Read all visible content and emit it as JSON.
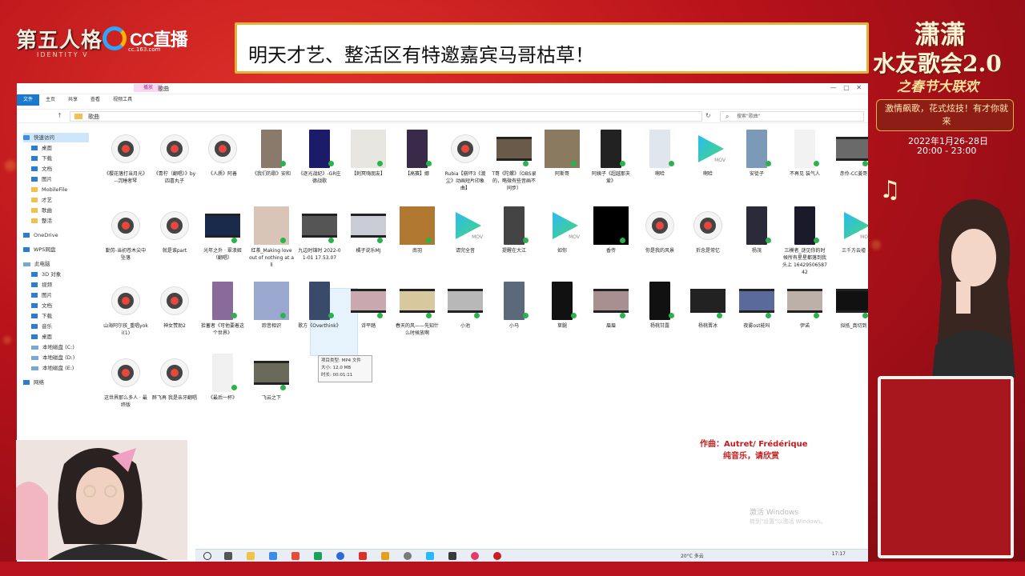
{
  "overlay": {
    "game_logo": "第五人格",
    "game_logo_sub": "IDENTITY V",
    "cc_logo": "CC直播",
    "cc_url": "cc.163.com",
    "banner": "明天才艺、整活区有特邀嘉宾马哥枯草！",
    "event_title": "潇潇",
    "event_title2": "水友歌会2.0",
    "event_sub": "之春节大联欢",
    "event_slogan": "激情飙歌，花式炫技！有才你就来",
    "event_date": "2022年1月26-28日",
    "event_time": "20:00 - 23:00",
    "lyric_credit": "作曲：Autret/ Frédérique",
    "lyric_credit2": "纯音乐，请欣赏",
    "windows_activate": "激活 Windows",
    "windows_activate2": "转到\"设置\"以激活 Windows。"
  },
  "explorer": {
    "window_title": "歌曲",
    "manage_tab": "播放",
    "ribbon_tabs": [
      "文件",
      "主页",
      "共享",
      "查看",
      "视频工具"
    ],
    "address": "歌曲",
    "search_placeholder": "搜索\"歌曲\"",
    "nav": [
      "快速访问",
      "桌面",
      "下载",
      "文档",
      "图片",
      "MobileFile",
      "才艺",
      "歌曲",
      "整活",
      "OneDrive",
      "WPS网盘",
      "此电脑",
      "3D 对象",
      "视频",
      "图片",
      "文档",
      "下载",
      "音乐",
      "桌面",
      "本地磁盘 (C:)",
      "本地磁盘 (D:)",
      "本地磁盘 (E:)",
      "网络"
    ],
    "files_row1": [
      {
        "name": "《樱花落打当月光》--沉睡者琴",
        "kind": "audio"
      },
      {
        "name": "《青柠（翻唱）》by四喜丸子",
        "kind": "audio"
      },
      {
        "name": "《人质》阿善",
        "kind": "audio"
      },
      {
        "name": "《我们的歌》安和",
        "kind": "video-portrait",
        "color": "#8a7a6c"
      },
      {
        "name": "《逐光战纪》-GR庄德战歌",
        "kind": "video-portrait",
        "color": "#1b1b6a"
      },
      {
        "name": "【刺冥嗨朋友】",
        "kind": "square",
        "color": "#e8e6e0"
      },
      {
        "name": "【高赛】娜",
        "kind": "video-portrait",
        "color": "#3a2a4a"
      },
      {
        "name": "Rubia【崩坏3《渡尘》动画短片印象曲】",
        "kind": "audio"
      },
      {
        "name": "T哥《陀螺》（OBS录的，略微有些音画不同步）",
        "kind": "landscape",
        "color": "#6a5a4a"
      },
      {
        "name": "阿斯哥",
        "kind": "square",
        "color": "#8a7a60"
      },
      {
        "name": "阿姨子《超越那夫爱》",
        "kind": "video-portrait",
        "color": "#222"
      },
      {
        "name": "啊哈",
        "kind": "video-portrait",
        "color": "#dfe6ee"
      },
      {
        "name": "啊哈",
        "kind": "qq"
      },
      {
        "name": "安徒子",
        "kind": "video-portrait",
        "color": "#7a9ab8"
      },
      {
        "name": "不再见 装气人",
        "kind": "video-portrait",
        "color": "#f2f2f2"
      },
      {
        "name": "赤伶-CC姜哥",
        "kind": "landscape",
        "color": "#6a6a6a"
      }
    ],
    "files_row2": [
      {
        "name": "勤劳-当初苍木尖中坠落",
        "kind": "audio"
      },
      {
        "name": "就是谁part",
        "kind": "audio"
      },
      {
        "name": "光年之外 · 翠浪姬（翻唱）",
        "kind": "landscape",
        "color": "#1a2a4a"
      },
      {
        "name": "红茶_Making love out of nothing at all",
        "kind": "square",
        "color": "#d9c5b8"
      },
      {
        "name": "九边时锦时 2022-01-01 17.53.07",
        "kind": "landscape",
        "color": "#555"
      },
      {
        "name": "橘子说乐MJ",
        "kind": "landscape",
        "color": "#c9ccd4"
      },
      {
        "name": "南羽",
        "kind": "square",
        "color": "#b07830"
      },
      {
        "name": "请完全音",
        "kind": "qq"
      },
      {
        "name": "提醒在大江",
        "kind": "video-portrait",
        "color": "#444"
      },
      {
        "name": "如你",
        "kind": "qq"
      },
      {
        "name": "香传",
        "kind": "square",
        "color": "#000"
      },
      {
        "name": "你是我的风景",
        "kind": "audio"
      },
      {
        "name": "折念是常忆",
        "kind": "audio"
      },
      {
        "name": "杨茂",
        "kind": "video-portrait",
        "color": "#2a2a3a"
      },
      {
        "name": "三模者_谜见你的时候所有星星都落到我头上 1642950658742",
        "kind": "video-portrait",
        "color": "#1a1a2a"
      },
      {
        "name": "三千方云墟",
        "kind": "qq"
      }
    ],
    "files_row3": [
      {
        "name": "山海阿尔孩_重唱yoki(1)",
        "kind": "audio"
      },
      {
        "name": "神女赞助2",
        "kind": "audio"
      },
      {
        "name": "拾蓄者《可他要着这个世界》",
        "kind": "video-portrait",
        "color": "#8a6a9a"
      },
      {
        "name": "踪昔相识",
        "kind": "square",
        "color": "#9aa8d0"
      },
      {
        "name": "歌方《Overthink》",
        "kind": "video-portrait",
        "color": "#3a4a6a"
      },
      {
        "name": "诗平踏",
        "kind": "landscape",
        "color": "#c9a8b0"
      },
      {
        "name": "春天的风——先知什么时候放啊",
        "kind": "landscape",
        "color": "#d8c8a0"
      },
      {
        "name": "小池",
        "kind": "landscape",
        "color": "#b8b8b8"
      },
      {
        "name": "小马",
        "kind": "video-portrait",
        "color": "#5a6a7a"
      },
      {
        "name": "草腿",
        "kind": "video-portrait",
        "color": "#111"
      },
      {
        "name": "眉眉",
        "kind": "landscape",
        "color": "#a89090"
      },
      {
        "name": "杨桃甘露",
        "kind": "video-portrait",
        "color": "#111"
      },
      {
        "name": "杨桃晋冰",
        "kind": "landscape",
        "color": "#222"
      },
      {
        "name": "夜雾ost能叫",
        "kind": "landscape",
        "color": "#5a6a9a"
      },
      {
        "name": "伊诺",
        "kind": "landscape",
        "color": "#bcb0a8"
      },
      {
        "name": "拟抵_真切到",
        "kind": "landscape",
        "color": "#111"
      }
    ],
    "files_row4": [
      {
        "name": "这世界那么多人 · 最终版",
        "kind": "audio"
      },
      {
        "name": "醉飞再 我是亲牙翻唱",
        "kind": "audio"
      },
      {
        "name": "《最后一杯》",
        "kind": "video-portrait",
        "color": "#f0f0f0"
      },
      {
        "name": "飞云之下",
        "kind": "landscape",
        "color": "#6a6a5a"
      }
    ],
    "tooltip": [
      "项目类型: MP4 文件",
      "大小: 12.0 MB",
      "时长: 00:01:11"
    ],
    "taskbar_weather": "20°C 多云",
    "taskbar_time": "17:17"
  }
}
